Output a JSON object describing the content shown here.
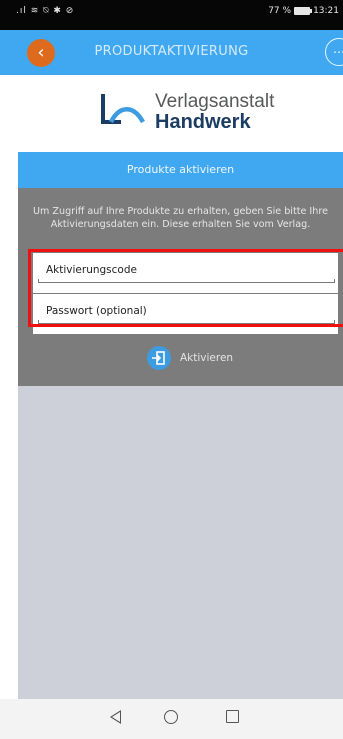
{
  "status_bar": {
    "left_icons": "໑จ ❄ ⌀ ✱ ⊘",
    "battery_text": "77 %",
    "time": "13:21"
  },
  "app_bar": {
    "title": "PRODUKTAKTIVIERUNG",
    "back_icon": "‹",
    "more_icon": "⋯"
  },
  "logo": {
    "line1": "Verlagsanstalt",
    "line2": "Handwerk"
  },
  "section": {
    "title": "Produkte aktivieren",
    "intro": "Um Zugriff auf Ihre Produkte zu erhalten, geben Sie bitte Ihre Aktivierungsdaten ein. Diese erhalten Sie vom Verlag."
  },
  "fields": {
    "code_placeholder": "Aktivierungscode",
    "password_placeholder": "Passwort (optional)"
  },
  "activate": {
    "label": "Aktivieren",
    "icon": "⎘"
  },
  "colors": {
    "accent_blue": "#40a8f0",
    "back_orange": "#de6a1d",
    "form_gray": "#7c7c7c",
    "highlight_red": "#f01010"
  }
}
